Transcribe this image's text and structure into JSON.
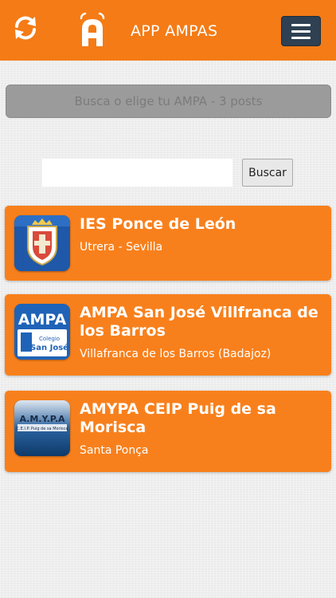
{
  "header": {
    "title": "APP AMPAS",
    "refresh_icon": "refresh-icon",
    "logo_icon": "app-logo-a-signal",
    "menu_icon": "hamburger-menu-icon",
    "bg_color": "#f47b16",
    "menu_button_color": "#2e4052"
  },
  "banner": {
    "text": "Busca o elige tu AMPA - 3 posts"
  },
  "search": {
    "value": "",
    "placeholder": "",
    "button_label": "Buscar"
  },
  "cards": [
    {
      "title": "IES Ponce de León",
      "subtitle": "Utrera - Sevilla",
      "thumb": "school-crest-icon"
    },
    {
      "title": "AMPA San José Villfranca de los Barros",
      "subtitle": "Villafranca de los Barros (Badajoz)",
      "thumb": "ampa-logo-icon",
      "thumb_text": "AMPA",
      "thumb_subtext": "Colegio San José"
    },
    {
      "title": "AMYPA CEIP Puig de sa Morisca",
      "subtitle": "Santa Ponça",
      "thumb": "amypa-logo-icon",
      "thumb_text": "A.M.Y.P.A",
      "thumb_subtext": "C.E.I.P. Puig de sa Morisca"
    }
  ],
  "colors": {
    "card_bg": "#f8801c",
    "accent": "#f47b16"
  }
}
